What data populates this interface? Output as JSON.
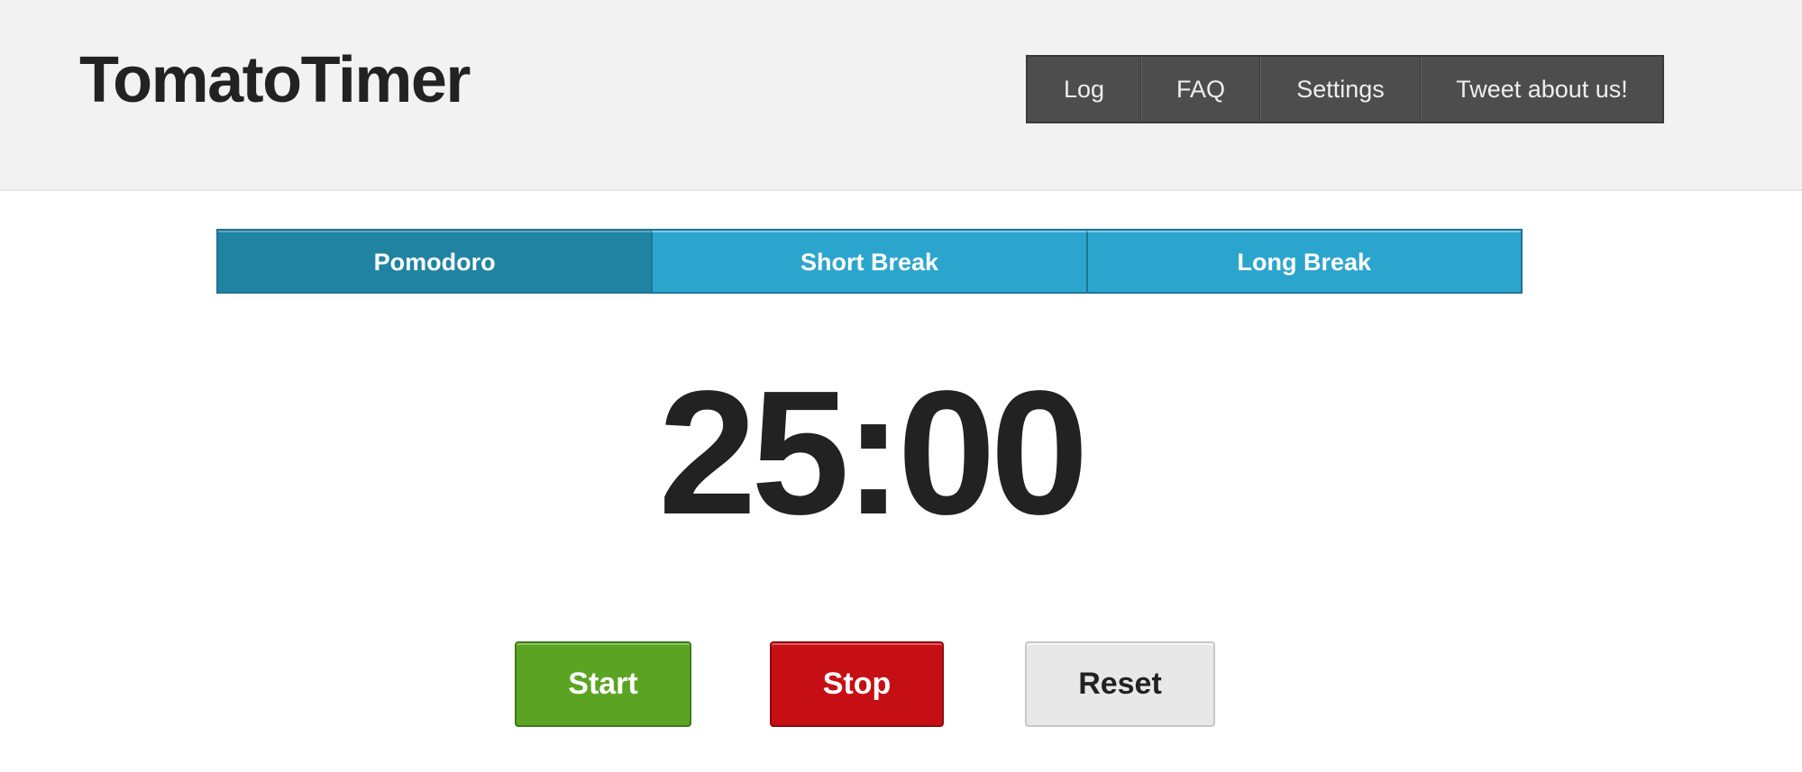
{
  "header": {
    "title": "TomatoTimer",
    "nav": [
      {
        "label": "Log"
      },
      {
        "label": "FAQ"
      },
      {
        "label": "Settings"
      },
      {
        "label": "Tweet about us!"
      }
    ]
  },
  "modes": {
    "active": "Pomodoro",
    "tabs": [
      {
        "label": "Pomodoro"
      },
      {
        "label": "Short Break"
      },
      {
        "label": "Long Break"
      }
    ]
  },
  "timer": {
    "display": "25:00"
  },
  "controls": {
    "start_label": "Start",
    "stop_label": "Stop",
    "reset_label": "Reset"
  },
  "colors": {
    "header_bg": "#f2f2f2",
    "nav_bg": "#4d4d4d",
    "tab_bg": "#2ca5ce",
    "tab_active_bg": "#2183a2",
    "start": "#5ba423",
    "stop": "#c60f14",
    "reset": "#e8e8e8",
    "text_dark": "#222222"
  }
}
